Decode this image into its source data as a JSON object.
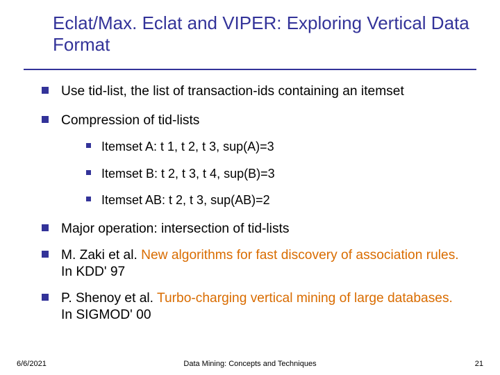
{
  "title": "Eclat/Max. Eclat and VIPER: Exploring Vertical Data Format",
  "bullets": {
    "b0": "Use tid-list, the list of transaction-ids containing an itemset",
    "b1": "Compression of tid-lists",
    "s0": "Itemset A: t 1, t 2, t 3, sup(A)=3",
    "s1": "Itemset B: t 2, t 3, t 4, sup(B)=3",
    "s2": "Itemset AB: t 2, t 3, sup(AB)=2",
    "b2": "Major operation: intersection of tid-lists",
    "b3a": "M. Zaki et al. ",
    "b3ref": "New algorithms for fast discovery of association rules.",
    "b3b": " In KDD' 97",
    "b4a": "P. Shenoy et al. ",
    "b4ref": "Turbo-charging vertical mining of large databases.",
    "b4b": " In SIGMOD' 00"
  },
  "footer": {
    "date": "6/6/2021",
    "center": "Data Mining: Concepts and Techniques",
    "page": "21"
  }
}
